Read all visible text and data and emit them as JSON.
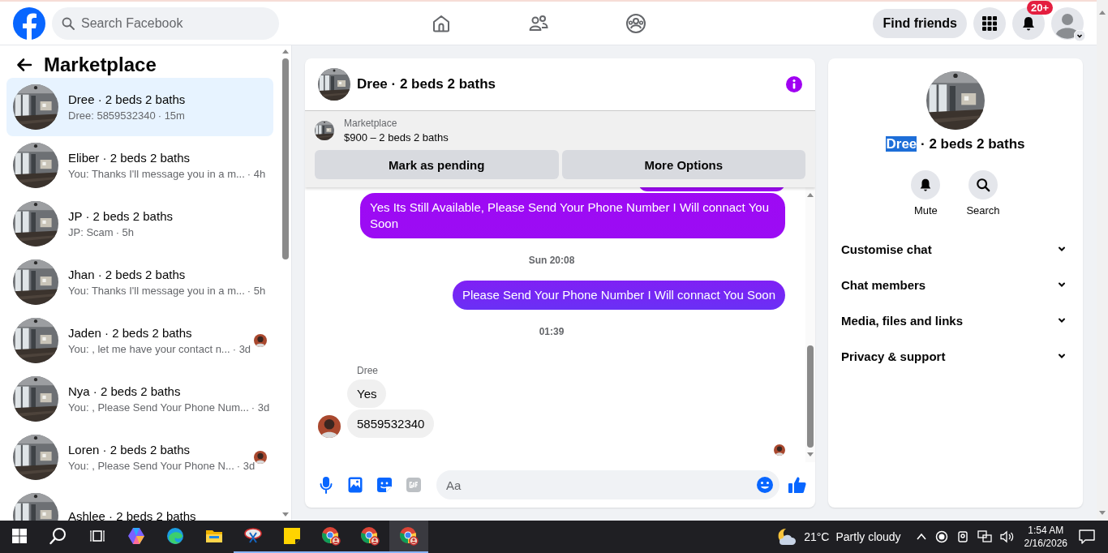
{
  "nav": {
    "search_placeholder": "Search Facebook",
    "find_friends": "Find friends",
    "notification_badge": "20+"
  },
  "sidebar": {
    "title": "Marketplace",
    "items": [
      {
        "name": "Dree · 2 beds 2 baths",
        "preview": "Dree: 5859532340",
        "time": "· 15m",
        "selected": true,
        "read_avatar": false
      },
      {
        "name": "Eliber · 2 beds 2 baths",
        "preview": "You: Thanks I'll message you in a m...",
        "time": "· 4h",
        "selected": false,
        "read_avatar": false
      },
      {
        "name": "JP · 2 beds 2 baths",
        "preview": "JP: Scam",
        "time": "· 5h",
        "selected": false,
        "read_avatar": false
      },
      {
        "name": "Jhan · 2 beds 2 baths",
        "preview": "You: Thanks I'll message you in a m...",
        "time": "· 5h",
        "selected": false,
        "read_avatar": false
      },
      {
        "name": "Jaden · 2 beds 2 baths",
        "preview": "You: , let me have your contact n...",
        "time": "· 3d",
        "selected": false,
        "read_avatar": true
      },
      {
        "name": "Nya · 2 beds 2 baths",
        "preview": "You: , Please Send Your Phone Num...",
        "time": "· 3d",
        "selected": false,
        "read_avatar": false
      },
      {
        "name": "Loren · 2 beds 2 baths",
        "preview": "You: , Please Send Your Phone N...",
        "time": "· 3d",
        "selected": false,
        "read_avatar": true
      },
      {
        "name": "Ashlee · 2 beds 2 baths",
        "selected": false,
        "read_avatar": false
      }
    ]
  },
  "chat": {
    "title": "Dree · 2 beds 2 baths",
    "listing": {
      "source": "Marketplace",
      "title": "$900 – 2 beds 2 baths"
    },
    "actions": [
      "Mark as pending",
      "More Options"
    ],
    "messages": [
      {
        "kind": "outgoing_cut"
      },
      {
        "kind": "outgoing",
        "text": "Yes Its Still Available, Please Send Your Phone Number I Will connact You Soon"
      },
      {
        "kind": "time",
        "text": "Sun 20:08"
      },
      {
        "kind": "outgoing",
        "text": "Please Send Your Phone Number I Will connact You Soon"
      },
      {
        "kind": "time",
        "text": "01:39"
      },
      {
        "kind": "sender",
        "text": "Dree"
      },
      {
        "kind": "incoming",
        "text": "Yes",
        "avatar": false
      },
      {
        "kind": "incoming",
        "text": "5859532340",
        "avatar": true
      },
      {
        "kind": "read_receipt"
      }
    ],
    "composer_placeholder": "Aa"
  },
  "details": {
    "title_parts": [
      {
        "text": "Dree",
        "selected": true
      },
      {
        "text": " · 2 beds 2 baths",
        "selected": false
      }
    ],
    "actions": [
      {
        "kind": "bell",
        "label": "Mute"
      },
      {
        "kind": "search",
        "label": "Search"
      }
    ],
    "sections": [
      {
        "label": "Customise chat",
        "expanded": false
      },
      {
        "label": "Chat members",
        "expanded": false
      },
      {
        "label": "Media, files and links",
        "expanded": false
      },
      {
        "label": "Privacy & support",
        "expanded": false
      }
    ]
  },
  "taskbar": {
    "apps": [
      {
        "kind": "copilot",
        "running": false,
        "active": false
      },
      {
        "kind": "edge",
        "running": false,
        "active": false
      },
      {
        "kind": "explorer",
        "running": false,
        "active": false
      },
      {
        "kind": "snip",
        "running": true,
        "active": false
      },
      {
        "kind": "sticky",
        "running": true,
        "active": false
      },
      {
        "kind": "chrome",
        "running": true,
        "active": false
      },
      {
        "kind": "chrome",
        "running": true,
        "active": false
      },
      {
        "kind": "chrome",
        "running": true,
        "active": true
      }
    ],
    "weather": {
      "temp": "21°C",
      "text": "Partly cloudy"
    },
    "time": "1:54 AM",
    "date": "2/16/2026"
  }
}
